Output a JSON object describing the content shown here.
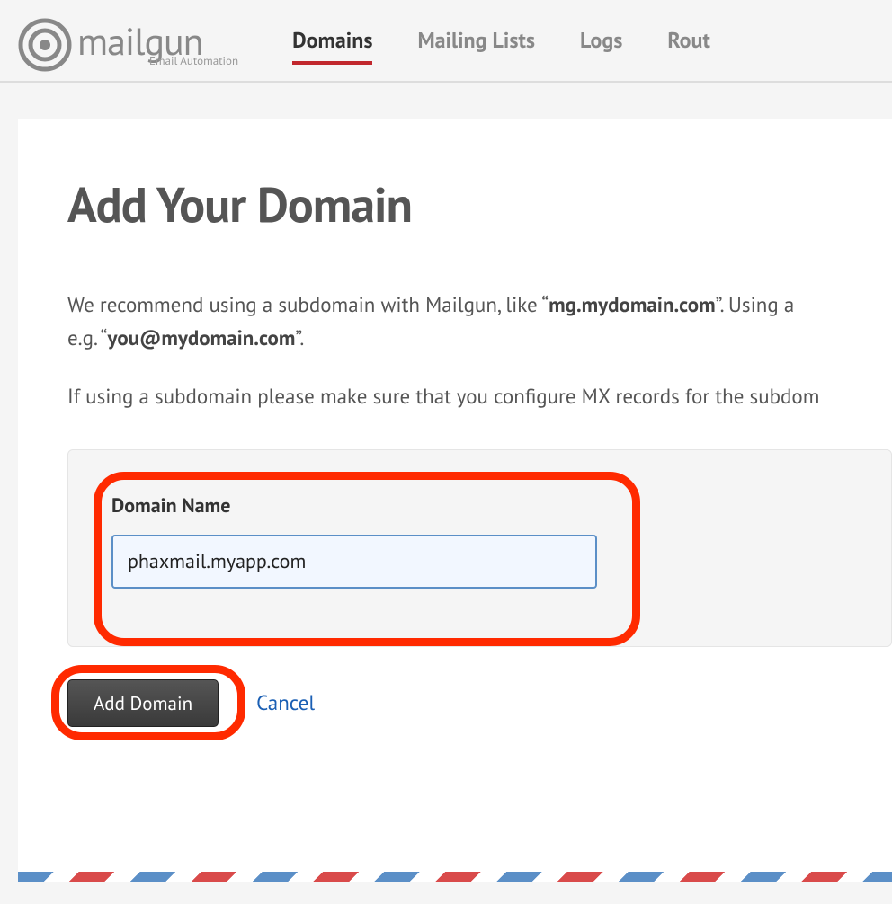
{
  "brand": {
    "name": "mailgun",
    "tagline": "Email Automation"
  },
  "nav": {
    "items": [
      {
        "label": "Domains",
        "active": true
      },
      {
        "label": "Mailing Lists",
        "active": false
      },
      {
        "label": "Logs",
        "active": false
      },
      {
        "label": "Rout",
        "active": false
      }
    ]
  },
  "page": {
    "title": "Add Your Domain",
    "intro_line1_a": "We recommend using a subdomain with Mailgun, like “",
    "intro_line1_bold": "mg.mydomain.com",
    "intro_line1_b": "”. Using a",
    "intro_line2_a": "e.g. “",
    "intro_line2_bold": "you@mydomain.com",
    "intro_line2_b": "”.",
    "intro_line3": "If using a subdomain please make sure that you configure MX records for the subdom"
  },
  "form": {
    "domain_label": "Domain Name",
    "domain_value": "phaxmail.myapp.com",
    "submit_label": "Add Domain",
    "cancel_label": "Cancel"
  },
  "colors": {
    "highlight": "#ff2a00",
    "accent": "#c1272d",
    "link": "#1a5fb4"
  }
}
